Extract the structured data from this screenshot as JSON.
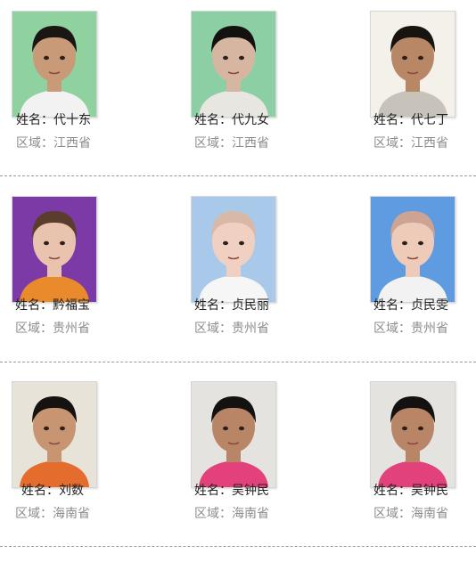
{
  "rows": [
    {
      "cards": [
        {
          "name_label": "姓名：代十东",
          "region_label": "区域：江西省",
          "photo": {
            "bg": "#8fd29f",
            "skin": "#c99a78",
            "hair": "#1a1614",
            "shirt": "#f2f2f2"
          }
        },
        {
          "name_label": "姓名：代九女",
          "region_label": "区域：江西省",
          "photo": {
            "bg": "#8ccfa5",
            "skin": "#d7b6a1",
            "hair": "#141210",
            "shirt": "#e8e6e0"
          }
        },
        {
          "name_label": "姓名：代七丁",
          "region_label": "区域：江西省",
          "photo": {
            "bg": "#f4f1ea",
            "skin": "#b88866",
            "hair": "#17130f",
            "shirt": "#c7c3bb"
          }
        }
      ]
    },
    {
      "cards": [
        {
          "name_label": "姓名：黔福宝",
          "region_label": "区域：贵州省",
          "photo": {
            "bg": "#7b3aa6",
            "skin": "#e9c3ad",
            "hair": "#5a3d2d",
            "shirt": "#e98a2c"
          }
        },
        {
          "name_label": "姓名：贞民丽",
          "region_label": "区域：贵州省",
          "photo": {
            "bg": "#a9c9ea",
            "skin": "#f0d0c0",
            "hair": "#d8b9a8",
            "shirt": "#f6f6f6"
          }
        },
        {
          "name_label": "姓名：贞民雯",
          "region_label": "区域：贵州省",
          "photo": {
            "bg": "#5e9be0",
            "skin": "#edcbb8",
            "hair": "#cda493",
            "shirt": "#f2f2f2"
          }
        }
      ]
    },
    {
      "cards": [
        {
          "name_label": "姓名：刘数",
          "region_label": "区域：海南省",
          "photo": {
            "bg": "#e8e3d8",
            "skin": "#c79571",
            "hair": "#151211",
            "shirt": "#e46d2d"
          }
        },
        {
          "name_label": "姓名：吴钟民",
          "region_label": "区域：海南省",
          "photo": {
            "bg": "#e5e3df",
            "skin": "#b98567",
            "hair": "#141211",
            "shirt": "#e2417c"
          }
        },
        {
          "name_label": "姓名：吴钟民",
          "region_label": "区域：海南省",
          "photo": {
            "bg": "#e5e3df",
            "skin": "#b98567",
            "hair": "#141211",
            "shirt": "#e2417c"
          }
        }
      ]
    }
  ]
}
